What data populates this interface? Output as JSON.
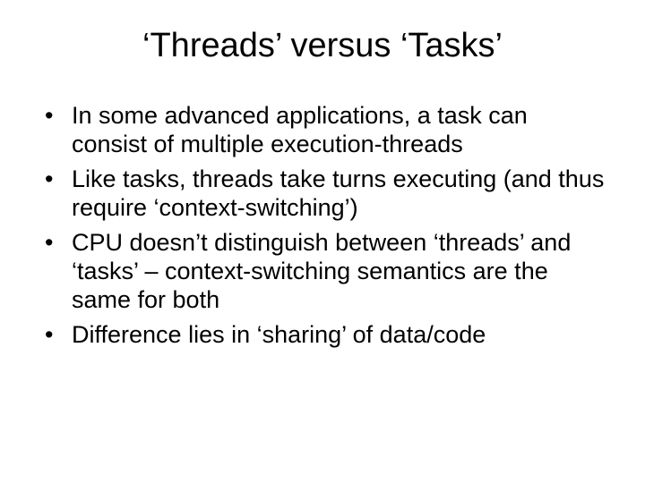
{
  "slide": {
    "title": "‘Threads’ versus ‘Tasks’",
    "bullets": [
      "In some advanced applications, a task can consist of multiple execution-threads",
      "Like tasks, threads take turns executing (and thus require ‘context-switching’)",
      "CPU doesn’t distinguish between ‘threads’ and ‘tasks’ – context-switching semantics are the same for both",
      "Difference lies in ‘sharing’ of data/code"
    ]
  }
}
